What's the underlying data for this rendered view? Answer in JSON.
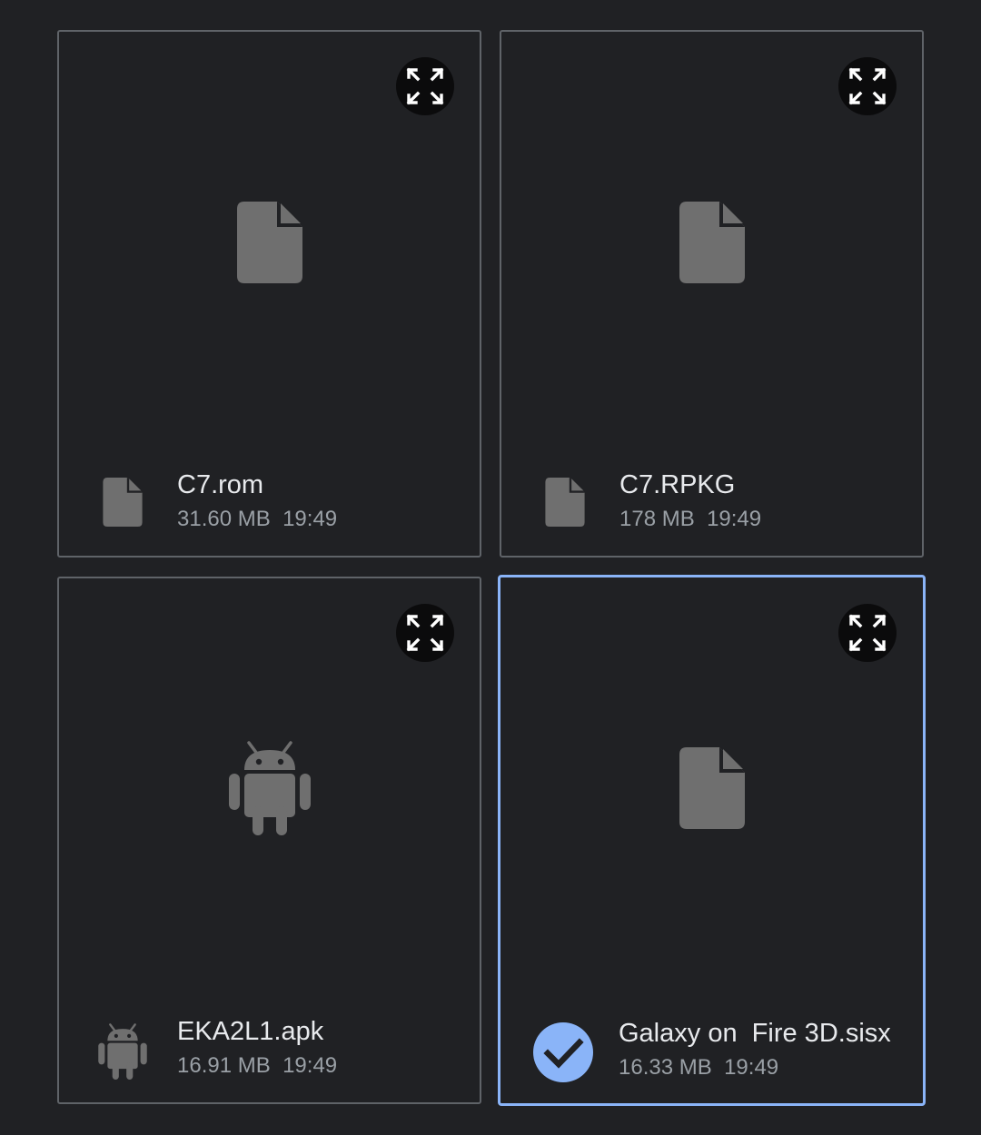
{
  "files": [
    {
      "name": "C7.rom",
      "size": "31.60 MB",
      "time": "19:49",
      "type_icon": "file-icon",
      "selected": false
    },
    {
      "name": "C7.RPKG",
      "size": "178 MB",
      "time": "19:49",
      "type_icon": "file-icon",
      "selected": false
    },
    {
      "name": "EKA2L1.apk",
      "size": "16.91 MB",
      "time": "19:49",
      "type_icon": "android-icon",
      "selected": false
    },
    {
      "name": "Galaxy on  Fire 3D.sisx",
      "size": "16.33 MB",
      "time": "19:49",
      "type_icon": "file-icon",
      "selected": true
    }
  ],
  "colors": {
    "background": "#202124",
    "card_border": "#5f6368",
    "selected_accent": "#8ab4f8",
    "icon_gray": "#6f6f6f",
    "name_text": "#e8eaed",
    "meta_text": "#9aa0a6"
  }
}
